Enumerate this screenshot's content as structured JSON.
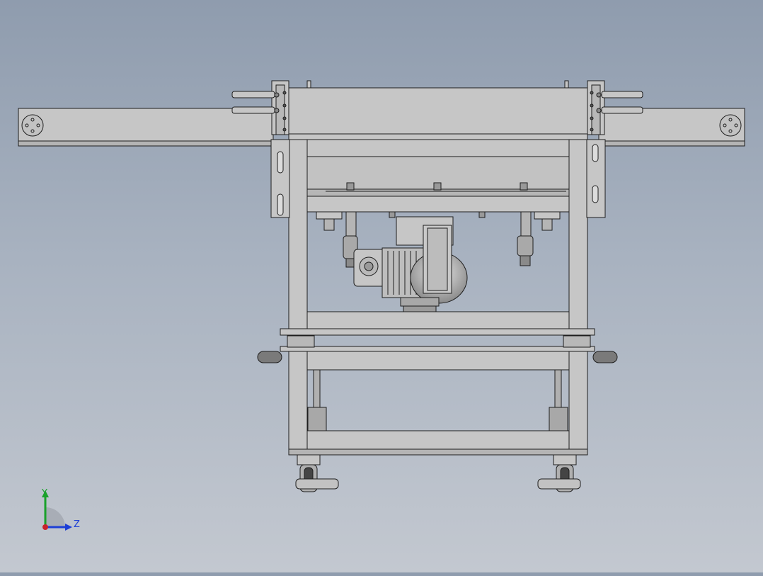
{
  "viewport": {
    "background_top": "#8f9cae",
    "background_bottom": "#c3c8d0",
    "model_fill": "#c6c6c6",
    "model_fill_dark": "#a9a9a9",
    "model_edge": "#1e1e1e"
  },
  "triad": {
    "y_label": "Y",
    "z_label": "Z",
    "y_color": "#1aa12b",
    "z_color": "#1d3fd6",
    "x_color": "#c8232c"
  }
}
